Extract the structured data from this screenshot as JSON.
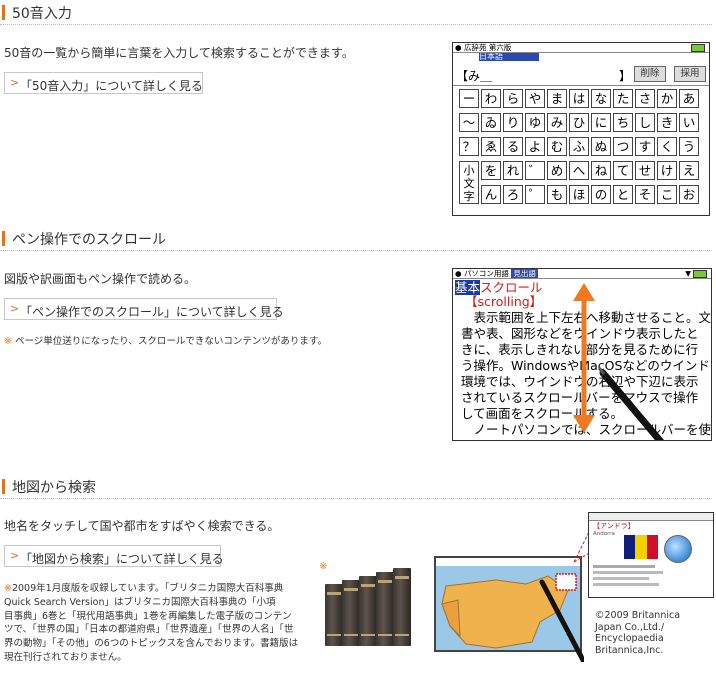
{
  "sections": [
    {
      "title": "50音入力",
      "desc": "50音の一覧から簡単に言葉を入力して検索することができます。",
      "button": "「50音入力」について詳しく見る"
    },
    {
      "title": "ペン操作でのスクロール",
      "desc": "図版や訳画面もペン操作で読める。",
      "button": "「ペン操作でのスクロール」について詳しく見る",
      "note_mark": "※",
      "note": "ページ単位送りになったり、スクロールできないコンテンツがあります。"
    },
    {
      "title": "地図から検索",
      "desc": "地名をタッチして国や都市をすばやく検索できる。",
      "button": "「地図から検索」について詳しく見る",
      "note_mark": "※",
      "note_lines": [
        "2009年1月度版を収録しています。「ブリタニカ国際大百科事典",
        "Quick Search Version」はブリタニカ国際大百科事典の「小項",
        "目事典」6巻と「現代用語事典」1巻を再編集した電子版のコンテン",
        "ツで、「世界の国」「日本の都道府県」「世界遺産」「世界の人名」「世",
        "界の動物」「その他」の6つのトピックスを含んでおります。書籍版は",
        "現在刊行されておりません。"
      ],
      "copyright_lines": [
        "©2009 Britannica",
        "Japan Co.,Ltd./",
        "Encyclopaedia",
        "Britannica,Inc."
      ],
      "photo_mark": "※"
    }
  ],
  "screen1": {
    "header": "広辞苑 第六版",
    "tab": "日本語",
    "input": "【み＿",
    "input_close": "】",
    "btn_delete": "削除",
    "btn_adopt": "採用",
    "rows": [
      [
        "ー",
        "わ",
        "ら",
        "や",
        "ま",
        "は",
        "な",
        "た",
        "さ",
        "か",
        "あ"
      ],
      [
        "～",
        "ゐ",
        "り",
        "ゆ",
        "み",
        "ひ",
        "に",
        "ち",
        "し",
        "き",
        "い"
      ],
      [
        "？",
        "ゑ",
        "る",
        "よ",
        "む",
        "ふ",
        "ぬ",
        "つ",
        "す",
        "く",
        "う"
      ],
      [
        "",
        "を",
        "れ",
        "゛",
        "め",
        "へ",
        "ね",
        "て",
        "せ",
        "け",
        "え"
      ],
      [
        "",
        "ん",
        "ろ",
        "゜",
        "も",
        "ほ",
        "の",
        "と",
        "そ",
        "こ",
        "お"
      ]
    ],
    "side_key": [
      "小",
      "文",
      "字"
    ]
  },
  "screen2": {
    "header": "パソコン用語",
    "header_tab": "見出語",
    "badge": "基本",
    "heading": "スクロール",
    "term": "【scrolling】",
    "lines": [
      "　表示範囲を上下左右へ移動させること。文",
      "書や表、図形などをウインドウ表示したと",
      "きに、表示しきれない部分を見るために行",
      "う操作。WindowsやMacOSなどのウインドウ",
      "環境では、ウインドウの右辺や下辺に表示",
      "されているスクロールバーをマウスで操作",
      "して画面をスクロールする。",
      "　ノートパソコンでは、スクロールバーを使"
    ]
  },
  "map_screen": {
    "popup_title": "【アンドラ】",
    "popup_sub": "Andorra"
  },
  "colors": {
    "accent": "#e8701a",
    "arrow": "#f07820",
    "link_red": "#d81818",
    "hl_blue": "#1a3aa8"
  }
}
